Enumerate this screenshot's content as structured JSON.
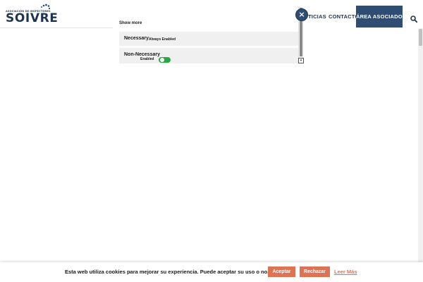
{
  "header": {
    "logo_subtitle": "ASOCIACIÓN DE INSPECTORES",
    "logo_title": "SOIVRE",
    "nav": {
      "noticias": "TICIAS",
      "contacto": "CONTACTO",
      "area": "ÁREA ASOCIADOS"
    },
    "search_icon": "search-icon"
  },
  "cookie_panel": {
    "show_more": "Show more",
    "categories": [
      {
        "title": "Necessary",
        "status": "Always Enabled"
      },
      {
        "title": "Non-Necessary",
        "status": "Enabled",
        "toggle_on": true
      }
    ],
    "close_label": "×"
  },
  "cookie_bar": {
    "message": "Esta web utiliza cookies para mejorar su experiencia. Puede aceptar su uso o no.",
    "accept": "Aceptar",
    "reject": "Rechazar",
    "read_more": "Leer Más"
  },
  "colors": {
    "brand": "#2f4d72",
    "accent": "#e07254",
    "toggle_on": "#28a745"
  }
}
